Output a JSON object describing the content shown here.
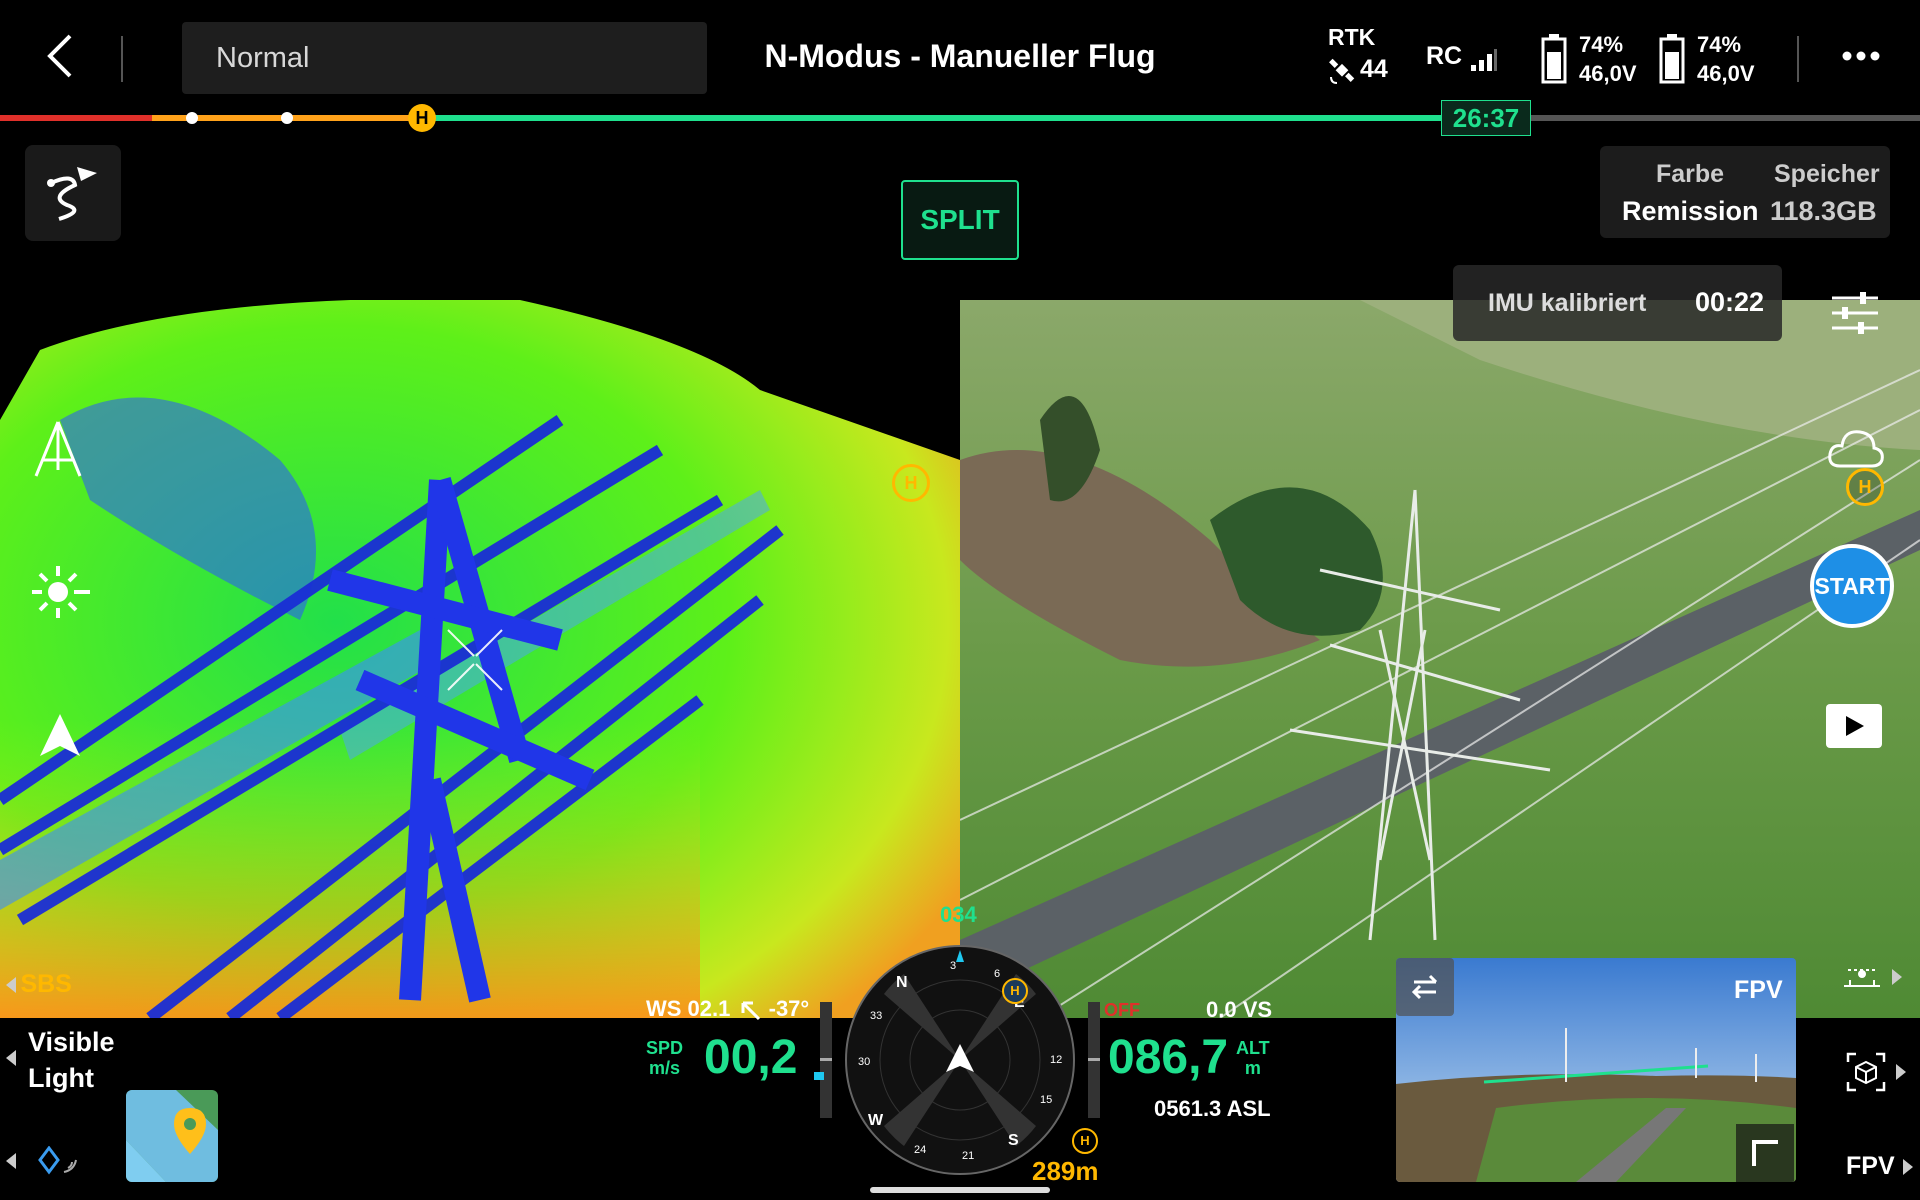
{
  "top_bar": {
    "flight_mode": "Normal",
    "title": "N-Modus - Manueller Flug",
    "rtk_label": "RTK",
    "rtk_satellites": "44",
    "rc_label": "RC",
    "battery_1_percent": "74%",
    "battery_1_voltage": "46,0V",
    "battery_2_percent": "74%",
    "battery_2_voltage": "46,0V"
  },
  "progress": {
    "remaining_time": "26:37",
    "home_marker": "H"
  },
  "split_button": "SPLIT",
  "info_panel": {
    "color_header": "Farbe",
    "color_value": "Remission",
    "storage_header": "Speicher",
    "storage_value": "118.3GB"
  },
  "imu": {
    "label": "IMU kalibriert",
    "time": "00:22"
  },
  "right_controls": {
    "start_label": "START",
    "home_marker": "H"
  },
  "lidar_panel": {
    "home_marker": "H",
    "view_mode": "SBS"
  },
  "source": {
    "line1": "Visible",
    "line2": "Light"
  },
  "telemetry": {
    "wind": "WS 02.1",
    "wind_angle": "-37°",
    "speed_label_1": "SPD",
    "speed_label_2": "m/s",
    "speed_value": "00,2",
    "heading": "034",
    "off_label": "OFF",
    "vs_value": "0.0 VS",
    "alt_value": "086,7",
    "alt_label_1": "ALT",
    "alt_label_2": "m",
    "asl_value": "0561.3 ASL",
    "home_distance": "289m",
    "home_marker": "H"
  },
  "compass": {
    "n": "N",
    "e": "E",
    "s": "S",
    "w": "W",
    "t3": "3",
    "t6": "6",
    "t12": "12",
    "t15": "15",
    "t21": "21",
    "t24": "24",
    "t30": "30",
    "t33": "33"
  },
  "fpv": {
    "label": "FPV",
    "bottom_label": "FPV"
  },
  "colors": {
    "accent_green": "#1fe08e",
    "warning_yellow": "#ffb800",
    "danger_red": "#e0302a",
    "start_blue": "#1e8fe6"
  }
}
